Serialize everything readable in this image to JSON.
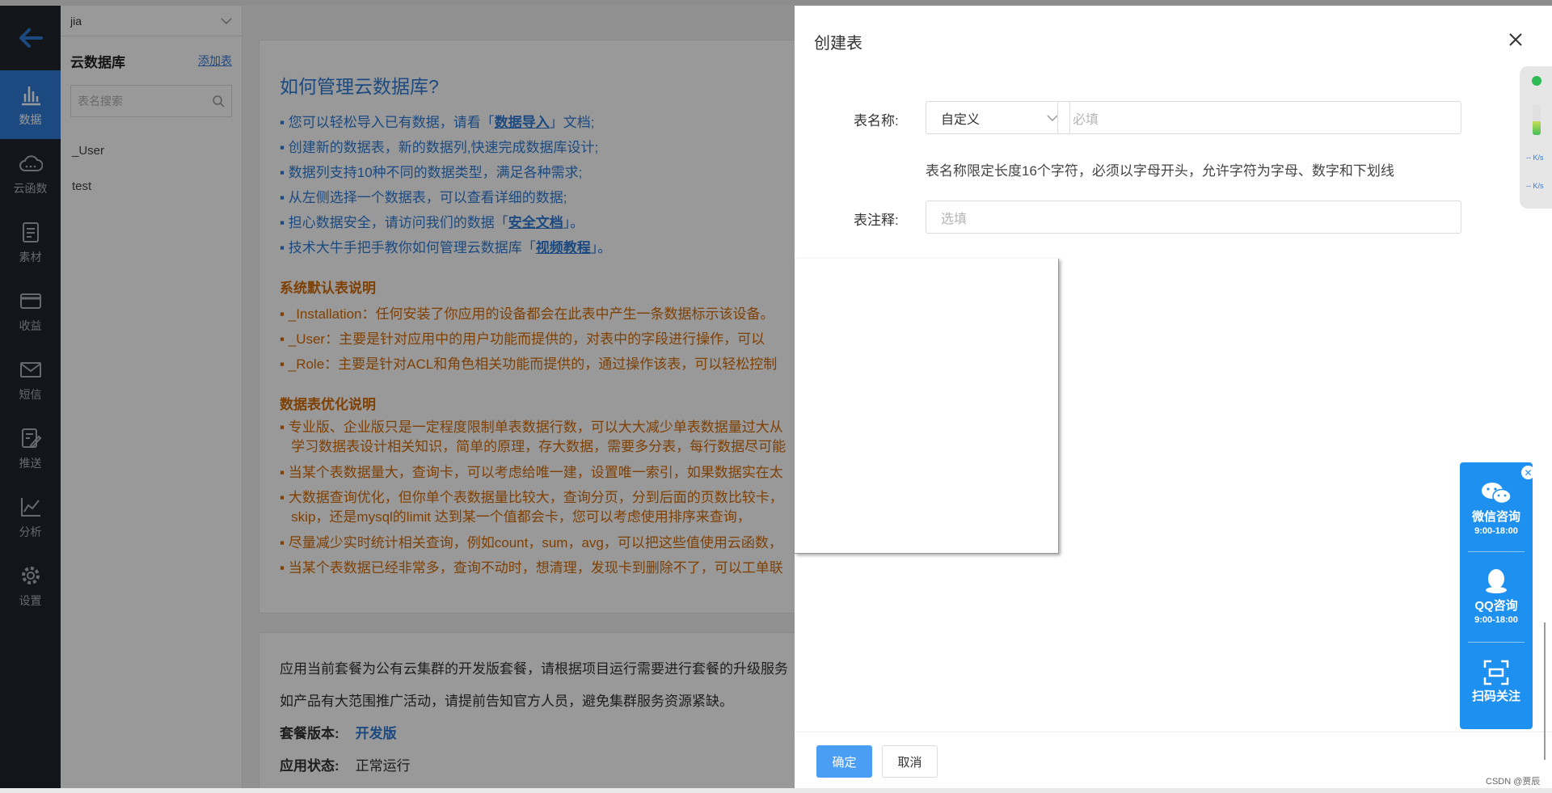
{
  "nav": {
    "items": [
      {
        "label": "数据",
        "icon": "bar-chart-icon"
      },
      {
        "label": "云函数",
        "icon": "cloud-icon"
      },
      {
        "label": "素材",
        "icon": "document-icon"
      },
      {
        "label": "收益",
        "icon": "card-icon"
      },
      {
        "label": "短信",
        "icon": "mail-icon"
      },
      {
        "label": "推送",
        "icon": "push-icon"
      },
      {
        "label": "分析",
        "icon": "analytics-icon"
      },
      {
        "label": "设置",
        "icon": "gear-icon"
      }
    ]
  },
  "sidebar": {
    "app_name": "jia",
    "title": "云数据库",
    "add_link": "添加表",
    "search_placeholder": "表名搜索",
    "tables": [
      "_User",
      "test"
    ]
  },
  "guide": {
    "title": "如何管理云数据库?",
    "l1_a": "您可以轻松导入已有数据，请看「",
    "l1_link": "数据导入",
    "l1_b": "」文档;",
    "l2": "创建新的数据表，新的数据列,快速完成数据库设计;",
    "l3": "数据列支持10种不同的数据类型，满足各种需求;",
    "l4": "从左侧选择一个数据表，可以查看详细的数据;",
    "l5_a": "担心数据安全，请访问我们的数据「",
    "l5_link": "安全文档",
    "l5_b": "」。",
    "l6_a": "技术大牛手把手教你如何管理云数据库「",
    "l6_link": "视频教程",
    "l6_b": "」。",
    "sec1": "系统默认表说明",
    "s1": "_Installation：任何安装了你应用的设备都会在此表中产生一条数据标示该设备。",
    "s2": "_User：主要是针对应用中的用户功能而提供的，对表中的字段进行操作，可以",
    "s3": "_Role：主要是针对ACL和角色相关功能而提供的，通过操作该表，可以轻松控制",
    "sec2": "数据表优化说明",
    "o1a": "专业版、企业版只是一定程度限制单表数据行数，可以大大减少单表数据量过大从",
    "o1b": "学习数据表设计相关知识，简单的原理，存大数据，需要多分表，每行数据尽可能",
    "o2": "当某个表数据量大，查询卡，可以考虑给唯一建，设置唯一索引，如果数据实在太",
    "o3a": "大数据查询优化，但你单个表数据量比较大，查询分页，分到后面的页数比较卡，",
    "o3b": "skip，还是mysql的limit 达到某一个值都会卡，您可以考虑使用排序来查询，",
    "o4": "尽量减少实时统计相关查询，例如count，sum，avg，可以把这些值使用云函数，",
    "o5": "当某个表数据已经非常多，查询不动时，想清理，发现卡到删除不了，可以工单联"
  },
  "plan": {
    "p1": "应用当前套餐为公有云集群的开发版套餐，请根据项目运行需要进行套餐的升级服务",
    "p2": "如产品有大范围推广活动，请提前告知官方人员，避免集群服务资源紧缺。",
    "version_label": "套餐版本:",
    "version_value": "开发版",
    "status_label": "应用状态:",
    "status_value": "正常运行"
  },
  "drawer": {
    "title": "创建表",
    "name_label": "表名称:",
    "name_type": "自定义",
    "name_placeholder": "必填",
    "hint": "表名称限定长度16个字符，必须以字母开头，允许字符为字母、数字和下划线",
    "comment_label": "表注释:",
    "comment_placeholder": "选填",
    "ok": "确定",
    "cancel": "取消"
  },
  "netmeter": {
    "up": "-- K/s",
    "down": "-- K/s"
  },
  "support": {
    "wechat": "微信咨询",
    "wechat_hours": "9:00-18:00",
    "qq": "QQ咨询",
    "qq_hours": "9:00-18:00",
    "scan": "扫码关注"
  },
  "watermark": "CSDN @贾辰"
}
